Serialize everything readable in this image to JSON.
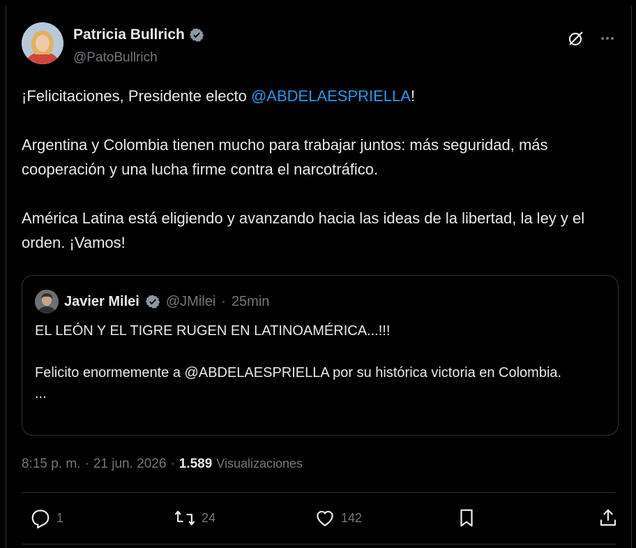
{
  "author": {
    "name": "Patricia Bullrich",
    "handle": "@PatoBullrich"
  },
  "tweet": {
    "line1_prefix": "¡Felicitaciones, Presidente electo ",
    "line1_mention": "@ABDELAESPRIELLA",
    "line1_suffix": "!",
    "paragraph2": "Argentina y Colombia tienen mucho para trabajar juntos: más seguridad, más cooperación y una lucha firme contra el narcotráfico.",
    "paragraph3": "América Latina está eligiendo y avanzando hacia las ideas de la libertad, la ley y el orden. ¡Vamos!"
  },
  "quote": {
    "name": "Javier Milei",
    "handle": "@JMilei",
    "separator": "·",
    "time": "25min",
    "line1": "EL LEÓN Y EL TIGRE RUGEN EN LATINOAMÉRICA...!!!",
    "line2": "Felicito enormemente a @ABDELAESPRIELLA por su histórica victoria en Colombia.",
    "ellipsis": "..."
  },
  "meta": {
    "time": "8:15 p. m.",
    "sep1": "·",
    "date": "21 jun. 2026",
    "sep2": "·",
    "views": "1.589",
    "views_label": "Visualizaciones"
  },
  "actions": {
    "replies": "1",
    "reposts": "24",
    "likes": "142"
  },
  "icons": {
    "verified": "verified-badge-icon",
    "grok": "grok-icon",
    "more": "more-icon",
    "reply": "reply-icon",
    "repost": "repost-icon",
    "like": "heart-icon",
    "bookmark": "bookmark-icon",
    "share": "share-icon"
  },
  "colors": {
    "background": "#000000",
    "text": "#e7e9ea",
    "secondary": "#71767b",
    "accent": "#1d9bf0",
    "border": "#2f3336"
  }
}
